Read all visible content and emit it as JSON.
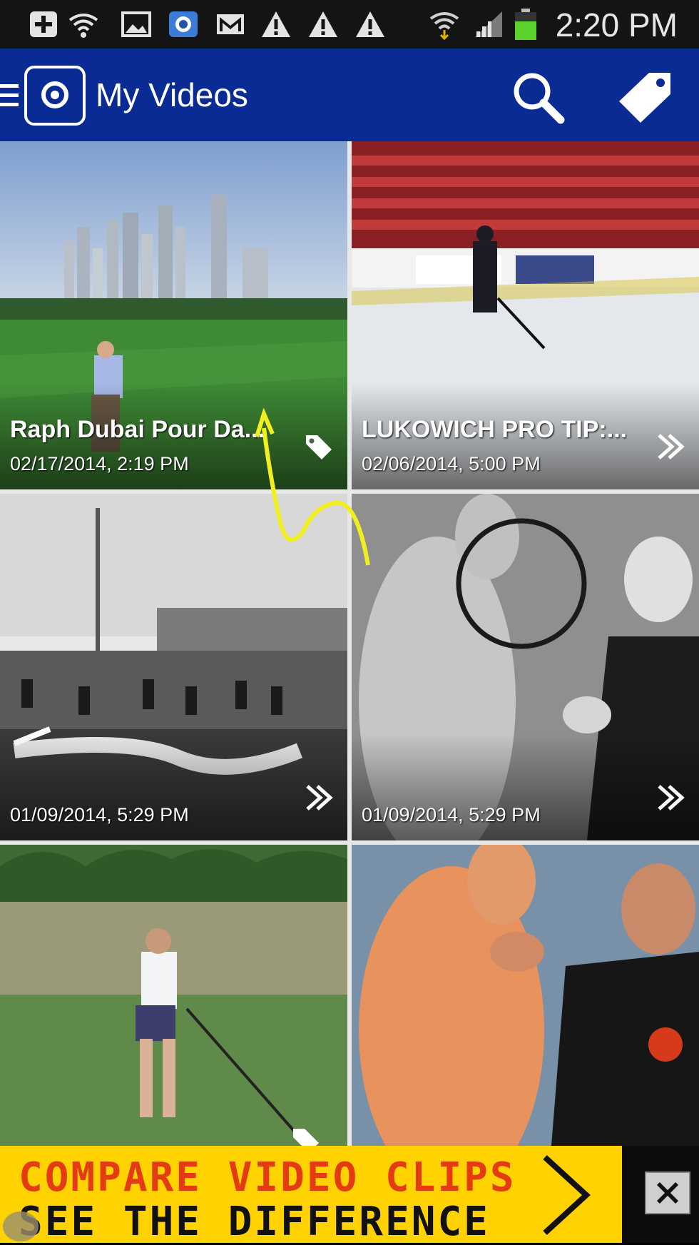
{
  "status_bar": {
    "time": "2:20 PM",
    "icons": [
      "add-icon",
      "wifi-icon",
      "image-icon",
      "camera-app-icon",
      "gmail-icon",
      "warning-icon",
      "warning-icon",
      "warning-icon",
      "wifi-signal-icon",
      "cell-signal-icon",
      "battery-icon"
    ]
  },
  "app_bar": {
    "title": "My Videos",
    "actions": [
      "search-icon",
      "tag-icon"
    ]
  },
  "videos": [
    {
      "title": "Raph Dubai Pour Da...",
      "date": "02/17/2014, 2:19 PM",
      "icon": "tag-icon"
    },
    {
      "title": "LUKOWICH PRO TIP:...",
      "date": "02/06/2014, 5:00 PM",
      "icon": "chevron-icon"
    },
    {
      "title": "",
      "date": "01/09/2014, 5:29 PM",
      "icon": "chevron-icon"
    },
    {
      "title": "",
      "date": "01/09/2014, 5:29 PM",
      "icon": "chevron-icon"
    },
    {
      "title": "",
      "date": "",
      "icon": "tag-icon"
    },
    {
      "title": "",
      "date": "",
      "icon": ""
    }
  ],
  "ad": {
    "line1": "COMPARE VIDEO CLIPS",
    "line2": "SEE THE DIFFERENCE",
    "colors": {
      "background": "#ffd200",
      "line1": "#e53b12",
      "line2": "#111111"
    }
  },
  "colors": {
    "app_bar": "#0a2b94",
    "status_bar": "#141414",
    "annotation": "#f2ef20"
  }
}
